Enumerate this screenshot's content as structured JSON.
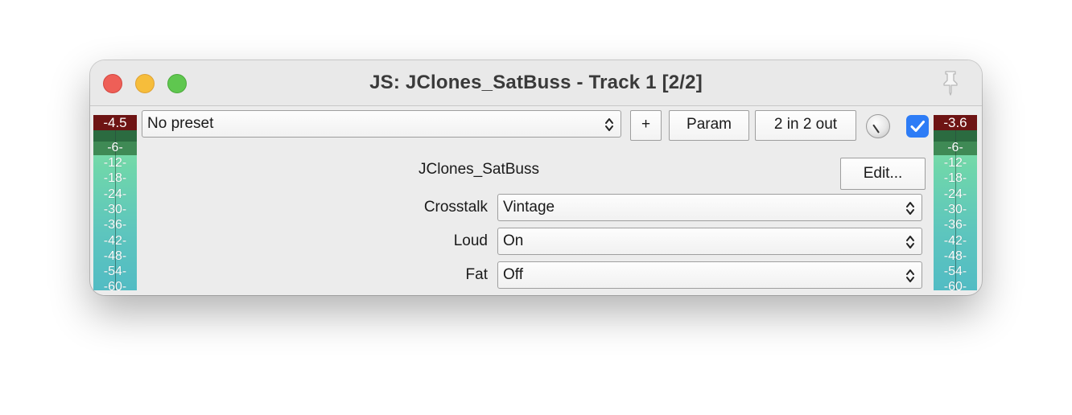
{
  "window": {
    "title": "JS: JClones_SatBuss - Track 1 [2/2]"
  },
  "toolbar": {
    "preset": "No preset",
    "plus_label": "+",
    "param_label": "Param",
    "io_label": "2 in 2 out",
    "enabled": true
  },
  "meters": {
    "left_peak": "-4.5",
    "right_peak": "-3.6",
    "ticks": [
      "-6-",
      "-12-",
      "-18-",
      "-24-",
      "-30-",
      "-36-",
      "-42-",
      "-48-",
      "-54-",
      "-60-"
    ]
  },
  "plugin": {
    "name": "JClones_SatBuss",
    "edit_label": "Edit..."
  },
  "params": [
    {
      "label": "Crosstalk",
      "value": "Vintage"
    },
    {
      "label": "Loud",
      "value": "On"
    },
    {
      "label": "Fat",
      "value": "Off"
    }
  ],
  "colors": {
    "accent": "#2d7cf6",
    "meter_peak": "#6e1414",
    "close": "#ee5f57",
    "minimize": "#f6bd3b",
    "zoom": "#5fc74f"
  }
}
